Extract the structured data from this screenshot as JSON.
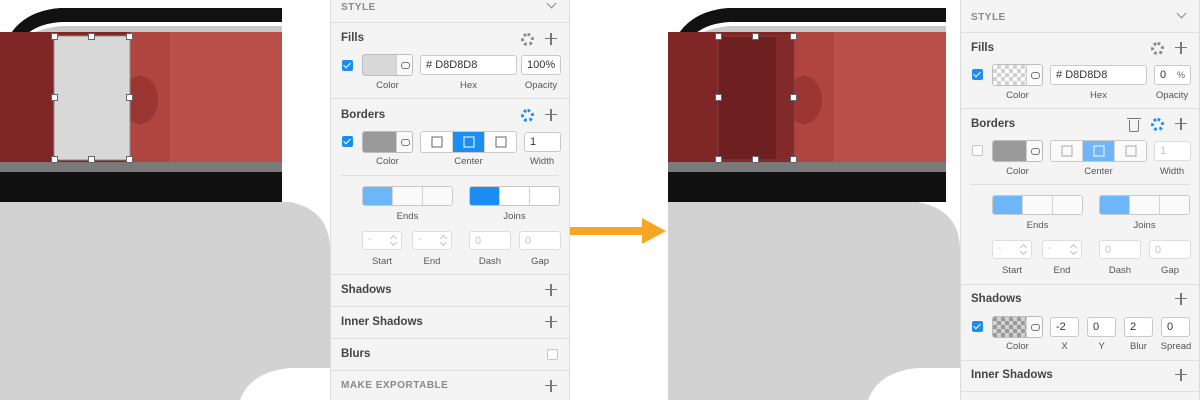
{
  "colors": {
    "accent": "#1a8ef5",
    "arrow": "#f5a623",
    "bus_red": "#8e2a2a",
    "fill_gray": "#d8d8d8"
  },
  "before": {
    "style_header": "STYLE",
    "fills": {
      "title": "Fills",
      "hex_prefix": "#",
      "hex": "D8D8D8",
      "opacity": "100%",
      "labels": {
        "color": "Color",
        "hex": "Hex",
        "opacity": "Opacity"
      }
    },
    "borders": {
      "title": "Borders",
      "width": "1",
      "labels": {
        "color": "Color",
        "position": "Center",
        "width": "Width"
      }
    },
    "ends_joins": {
      "ends": "Ends",
      "joins": "Joins",
      "start_value": "-",
      "end_value": "-",
      "dash_value": "0",
      "gap_value": "0",
      "start": "Start",
      "end": "End",
      "dash": "Dash",
      "gap": "Gap"
    },
    "shadows": "Shadows",
    "inner_shadows": "Inner Shadows",
    "blurs": "Blurs",
    "make_exportable": "MAKE EXPORTABLE"
  },
  "after": {
    "style_header": "STYLE",
    "fills": {
      "title": "Fills",
      "hex_prefix": "#",
      "hex": "D8D8D8",
      "opacity": "0",
      "opacity_unit": "%",
      "labels": {
        "color": "Color",
        "hex": "Hex",
        "opacity": "Opacity"
      }
    },
    "borders": {
      "title": "Borders",
      "width": "1",
      "labels": {
        "color": "Color",
        "position": "Center",
        "width": "Width"
      }
    },
    "ends_joins": {
      "ends": "Ends",
      "joins": "Joins",
      "start_value": "-",
      "end_value": "-",
      "dash_value": "0",
      "gap_value": "0",
      "start": "Start",
      "end": "End",
      "dash": "Dash",
      "gap": "Gap"
    },
    "shadows": {
      "title": "Shadows",
      "x": "-2",
      "y": "0",
      "blur": "2",
      "spread": "0",
      "labels": {
        "color": "Color",
        "x": "X",
        "y": "Y",
        "blur": "Blur",
        "spread": "Spread"
      }
    },
    "inner_shadows": "Inner Shadows"
  },
  "icons": [
    "gear-icon",
    "plus-icon",
    "chevron-down-icon",
    "trash-icon",
    "link-icon",
    "arrow-right-icon"
  ]
}
